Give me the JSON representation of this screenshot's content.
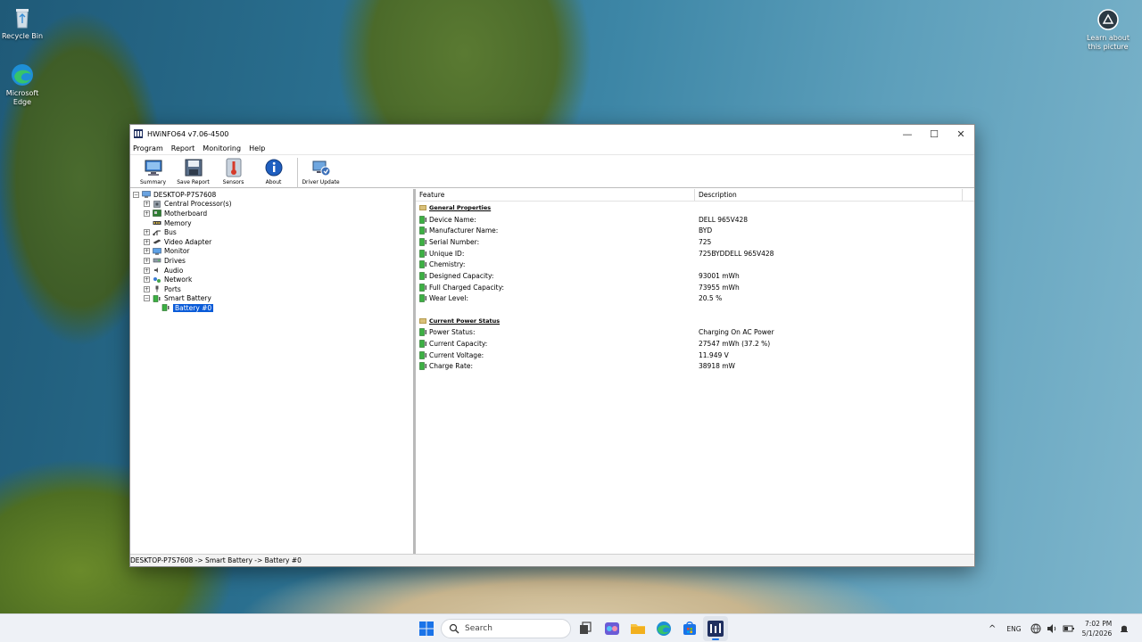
{
  "desktop": {
    "recycle_bin": "Recycle Bin",
    "edge": "Microsoft Edge",
    "learn": "Learn about this picture"
  },
  "window": {
    "title": "HWiNFO64 v7.06-4500",
    "controls": {
      "minimize": "—",
      "maximize": "☐",
      "close": "✕"
    }
  },
  "menu": [
    "Program",
    "Report",
    "Monitoring",
    "Help"
  ],
  "toolbar": [
    {
      "label": "Summary",
      "icon": "monitor-icon"
    },
    {
      "label": "Save Report",
      "icon": "floppy-disk-icon"
    },
    {
      "label": "Sensors",
      "icon": "thermometer-icon"
    },
    {
      "label": "About",
      "icon": "info-icon"
    },
    {
      "label": "Driver Update",
      "icon": "driver-update-icon"
    }
  ],
  "tree": {
    "root": "DESKTOP-P7S7608",
    "items": [
      {
        "label": "Central Processor(s)",
        "icon": "cpu-icon"
      },
      {
        "label": "Motherboard",
        "icon": "motherboard-icon"
      },
      {
        "label": "Memory",
        "icon": "memory-icon"
      },
      {
        "label": "Bus",
        "icon": "bus-icon"
      },
      {
        "label": "Video Adapter",
        "icon": "video-adapter-icon"
      },
      {
        "label": "Monitor",
        "icon": "monitor-icon"
      },
      {
        "label": "Drives",
        "icon": "drive-icon"
      },
      {
        "label": "Audio",
        "icon": "audio-icon"
      },
      {
        "label": "Network",
        "icon": "network-icon"
      },
      {
        "label": "Ports",
        "icon": "port-icon"
      },
      {
        "label": "Smart Battery",
        "icon": "battery-icon"
      }
    ],
    "selected_child": "Battery #0"
  },
  "details": {
    "col_feature": "Feature",
    "col_description": "Description",
    "general_title": "General Properties",
    "general": [
      {
        "feature": "Device Name:",
        "value": "DELL 965V428"
      },
      {
        "feature": "Manufacturer Name:",
        "value": "BYD"
      },
      {
        "feature": "Serial Number:",
        "value": "725"
      },
      {
        "feature": "Unique ID:",
        "value": "725BYDDELL 965V428"
      },
      {
        "feature": "Chemistry:",
        "value": ""
      },
      {
        "feature": "Designed Capacity:",
        "value": "93001 mWh"
      },
      {
        "feature": "Full Charged Capacity:",
        "value": "73955 mWh"
      },
      {
        "feature": "Wear Level:",
        "value": "20.5 %"
      }
    ],
    "power_title": "Current Power Status",
    "power": [
      {
        "feature": "Power Status:",
        "value": "Charging On AC Power"
      },
      {
        "feature": "Current Capacity:",
        "value": "27547 mWh (37.2 %)"
      },
      {
        "feature": "Current Voltage:",
        "value": "11.949 V"
      },
      {
        "feature": "Charge Rate:",
        "value": "38918 mW"
      }
    ]
  },
  "status_bar": "DESKTOP-P7S7608 -> Smart Battery -> Battery #0",
  "taskbar": {
    "search_placeholder": "Search",
    "lang": "ENG",
    "time": "7:02 PM",
    "date": "5/1/2026"
  }
}
